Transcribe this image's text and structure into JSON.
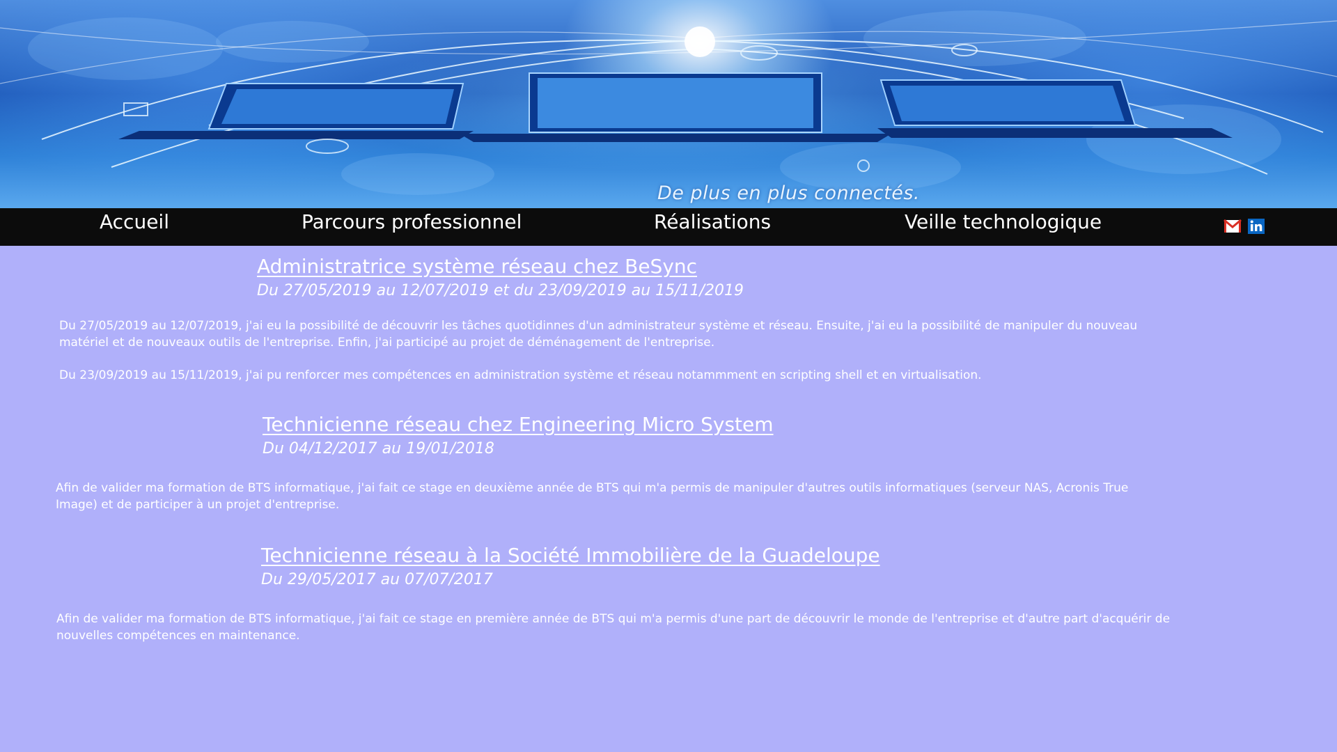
{
  "banner": {
    "tagline": "De plus en plus connectés."
  },
  "nav": {
    "items": [
      {
        "label": "Accueil"
      },
      {
        "label": "Parcours professionnel"
      },
      {
        "label": "Réalisations"
      },
      {
        "label": "Veille technologique"
      }
    ],
    "social": [
      {
        "icon": "gmail-icon"
      },
      {
        "icon": "linkedin-icon"
      }
    ]
  },
  "sections": [
    {
      "title": "Administratrice système réseau chez BeSync",
      "dates": "Du 27/05/2019 au 12/07/2019 et du 23/09/2019 au 15/11/2019",
      "paragraphs": [
        "Du 27/05/2019 au 12/07/2019, j'ai eu la possibilité de découvrir les tâches quotidinnes d'un administrateur système et réseau. Ensuite, j'ai eu la possibilité de manipuler du nouveau matériel et de nouveaux outils de l'entreprise. Enfin, j'ai participé au projet de déménagement de l'entreprise.",
        "Du 23/09/2019 au 15/11/2019, j'ai pu renforcer mes compétences en administration système et réseau notammment en scripting shell et en virtualisation."
      ]
    },
    {
      "title": "Technicienne réseau chez Engineering Micro System",
      "dates": "Du 04/12/2017 au 19/01/2018",
      "paragraphs": [
        "Afin de valider ma formation de BTS informatique, j'ai fait ce stage en deuxième année de BTS qui m'a permis de manipuler d'autres outils informatiques (serveur NAS, Acronis True Image) et de participer à un projet d'entreprise."
      ]
    },
    {
      "title": "Technicienne réseau à la Société Immobilière de la Guadeloupe",
      "dates": "Du 29/05/2017 au 07/07/2017",
      "paragraphs": [
        "Afin de valider ma formation de BTS informatique, j'ai fait ce stage en première année de BTS qui m'a permis d'une part de découvrir le monde de l'entreprise et d'autre part d'acquérir de nouvelles compétences en maintenance."
      ]
    }
  ],
  "colors": {
    "page_background": "#b0b0fa",
    "navbar_background": "#0c0c0c",
    "text": "#ffffff"
  }
}
